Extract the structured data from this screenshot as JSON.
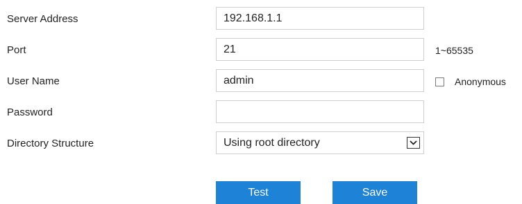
{
  "form": {
    "server_address": {
      "label": "Server Address",
      "value": "192.168.1.1"
    },
    "port": {
      "label": "Port",
      "value": "21",
      "range_hint": "1~65535"
    },
    "user_name": {
      "label": "User Name",
      "value": "admin"
    },
    "anonymous": {
      "label": "Anonymous",
      "checked": false
    },
    "password": {
      "label": "Password",
      "value": ""
    },
    "directory_structure": {
      "label": "Directory Structure",
      "selected": "Using root directory"
    }
  },
  "buttons": {
    "test_label": "Test",
    "save_label": "Save"
  },
  "colors": {
    "button_bg": "#1e82d6",
    "input_border": "#cfcfcf"
  }
}
